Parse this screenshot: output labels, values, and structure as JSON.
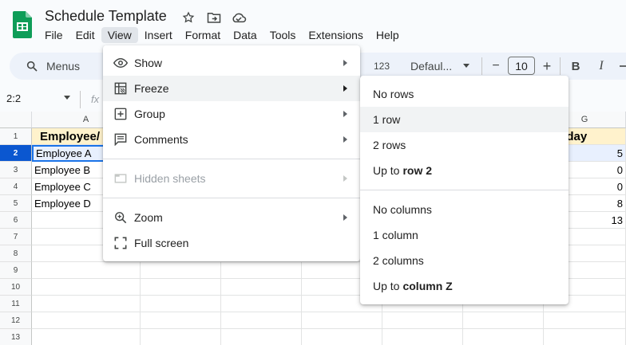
{
  "header": {
    "title": "Schedule Template",
    "menu": [
      "File",
      "Edit",
      "View",
      "Insert",
      "Format",
      "Data",
      "Tools",
      "Extensions",
      "Help"
    ]
  },
  "toolbar": {
    "search_label": "Menus",
    "number_format": "123",
    "font_name": "Defaul...",
    "font_size": "10",
    "minus": "−",
    "plus": "+",
    "bold": "B",
    "italic": "I"
  },
  "formula_bar": {
    "namebox": "2:2",
    "fx": "fx"
  },
  "grid": {
    "col_a": "A",
    "col_g": "G",
    "rows": [
      "1",
      "2",
      "3",
      "4",
      "5",
      "6",
      "7",
      "8",
      "9",
      "10",
      "11",
      "12",
      "13"
    ],
    "col_a_values": [
      "Employee/",
      "Employee A",
      "Employee B",
      "Employee C",
      "Employee D"
    ],
    "col_g_values": [
      "aturday",
      "5",
      "0",
      "0",
      "8",
      "13"
    ]
  },
  "view_menu": {
    "items": [
      {
        "label": "Show",
        "icon": "eye-icon",
        "submenu": true
      },
      {
        "label": "Freeze",
        "icon": "freeze-icon",
        "submenu": true
      },
      {
        "label": "Group",
        "icon": "group-icon",
        "submenu": true
      },
      {
        "label": "Comments",
        "icon": "comments-icon",
        "submenu": true
      },
      {
        "label": "Hidden sheets",
        "icon": "hidden-sheets-icon",
        "submenu": true,
        "disabled": true
      },
      {
        "label": "Zoom",
        "icon": "zoom-icon",
        "submenu": true
      },
      {
        "label": "Full screen",
        "icon": "fullscreen-icon",
        "submenu": false
      }
    ]
  },
  "freeze_menu": {
    "no_rows": "No rows",
    "one_row": "1 row",
    "two_rows": "2 rows",
    "up_to_row_prefix": "Up to",
    "up_to_row_value": "row 2",
    "no_columns": "No columns",
    "one_column": "1 column",
    "two_columns": "2 columns",
    "up_to_col_prefix": "Up to",
    "up_to_col_value": "column Z"
  },
  "colors": {
    "accent": "#0b57d0",
    "header_fill": "#fff2cc",
    "app_green": "#0f9d58"
  }
}
